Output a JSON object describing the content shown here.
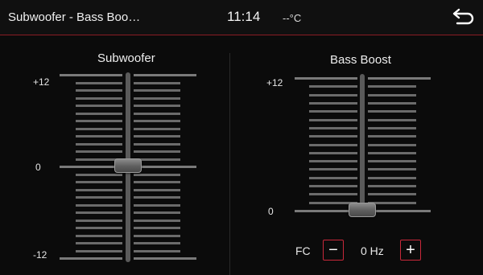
{
  "header": {
    "title": "Subwoofer - Bass Boo…",
    "time": "11:14",
    "temperature": "--°C",
    "back_icon": "return-arrow-icon"
  },
  "subwoofer": {
    "title": "Subwoofer",
    "max_label": "+12",
    "mid_label": "0",
    "min_label": "-12",
    "value": 0
  },
  "bass_boost": {
    "title": "Bass Boost",
    "max_label": "+12",
    "min_label": "0",
    "value": 0,
    "fc_label": "FC",
    "fc_value": "0 Hz",
    "minus_label": "−",
    "plus_label": "+"
  },
  "colors": {
    "accent": "#c8283a",
    "background": "#0b0b0b"
  }
}
